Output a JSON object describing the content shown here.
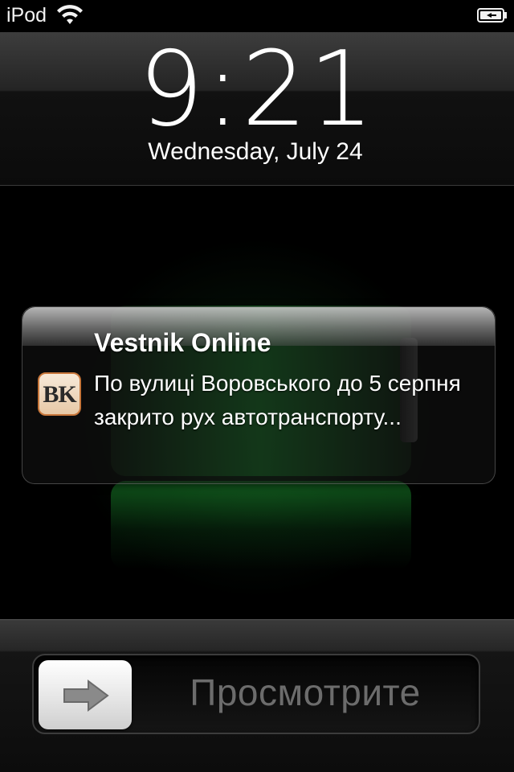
{
  "status_bar": {
    "carrier": "iPod",
    "wifi_icon": "wifi-icon",
    "battery_icon": "battery-charging-icon"
  },
  "lock_screen": {
    "time": "9:21",
    "date": "Wednesday, July 24"
  },
  "notification": {
    "app_name": "Vestnik Online",
    "app_icon_text": "BK",
    "message": "По вулиці Воровського до 5 серпня закрито рух автотранспорту..."
  },
  "slider": {
    "label": "Просмотрите",
    "arrow_icon": "arrow-right-icon"
  },
  "colors": {
    "charging_green": "#136a22",
    "app_icon_border": "#c8773b",
    "slider_label": "#6c6c6c"
  }
}
